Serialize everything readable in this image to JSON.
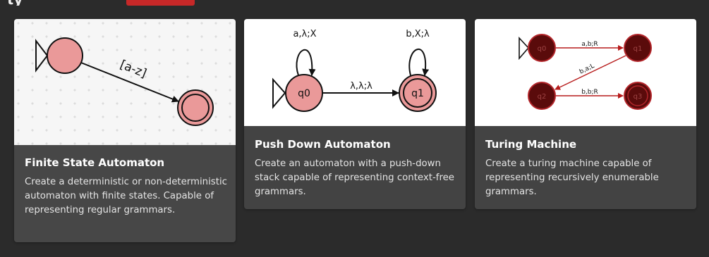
{
  "header": {
    "partial_title": "ty",
    "badge_color": "#c62828"
  },
  "cards": [
    {
      "title": "Finite State Automaton",
      "description": "Create a deterministic or non-deterministic automaton with finite states. Capable of representing regular grammars.",
      "selected": true,
      "diagram": {
        "transition_label": "[a-z]"
      }
    },
    {
      "title": "Push Down Automaton",
      "description": "Create an automaton with a push-down stack capable of representing context-free grammars.",
      "selected": false,
      "diagram": {
        "states": [
          "q0",
          "q1"
        ],
        "loop_q0": "a,λ;X",
        "loop_q1": "b,X;λ",
        "transition_q0_q1": "λ,λ;λ"
      }
    },
    {
      "title": "Turing Machine",
      "description": "Create a turing machine capable of representing recursively enumerable grammars.",
      "selected": false,
      "diagram": {
        "states": [
          "q0",
          "q1",
          "q2",
          "q3"
        ],
        "t_q0_q1": "a,b;R",
        "t_q1_q2": "b,a;L",
        "t_q2_q3": "b,b;R"
      }
    }
  ],
  "colors": {
    "state_fill": "#ea9999",
    "tm_state_fill": "#5a0b0b",
    "tm_state_stroke": "#b3262b",
    "tm_edge": "#b71c1c",
    "card_bg": "#434343",
    "page_bg": "#2b2b2b"
  }
}
